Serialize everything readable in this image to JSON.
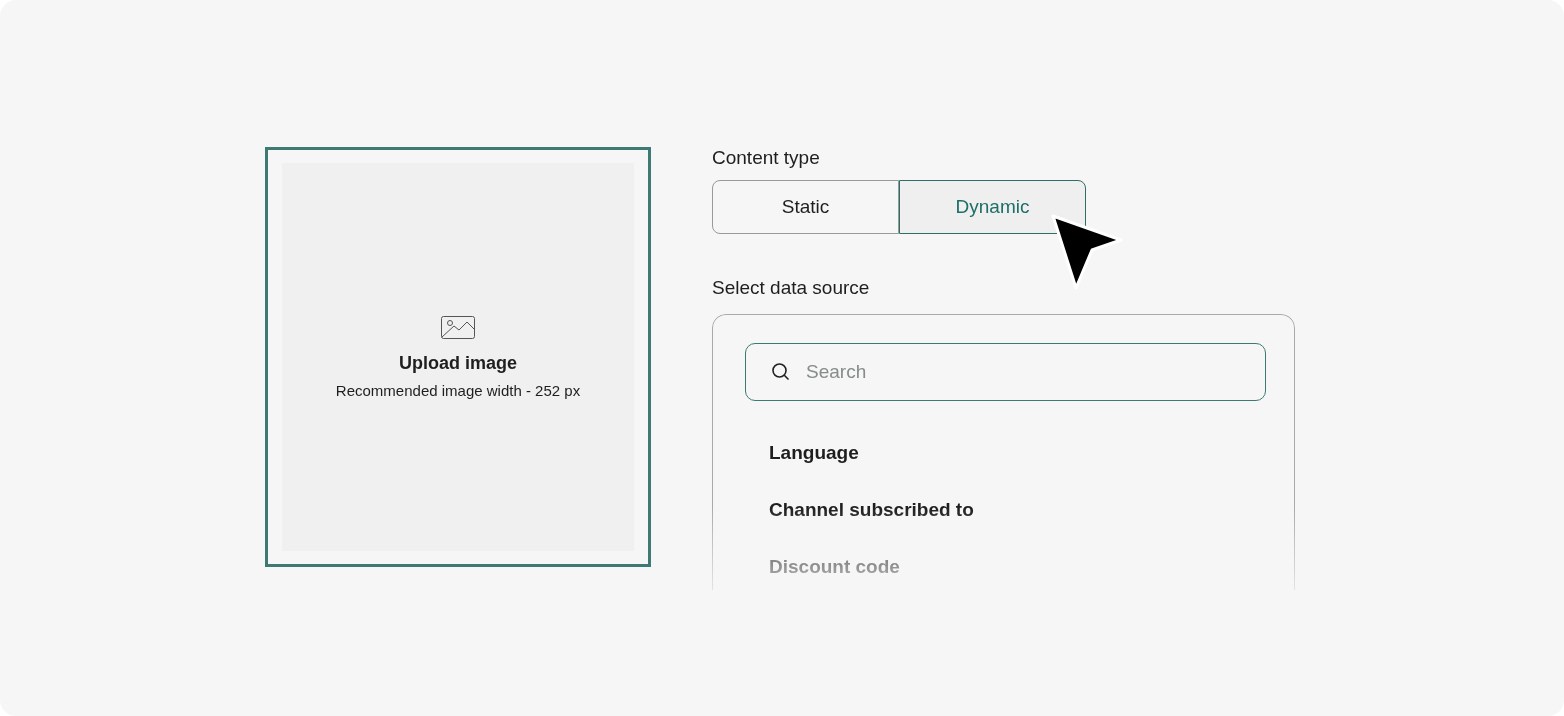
{
  "upload": {
    "title": "Upload image",
    "hint": "Recommended image width - 252 px"
  },
  "content_type": {
    "label": "Content type",
    "options": [
      {
        "label": "Static",
        "selected": false
      },
      {
        "label": "Dynamic",
        "selected": true
      }
    ]
  },
  "data_source": {
    "label": "Select data source",
    "search": {
      "placeholder": "Search"
    },
    "items": [
      "Language",
      "Channel subscribed to",
      "Discount code"
    ]
  }
}
